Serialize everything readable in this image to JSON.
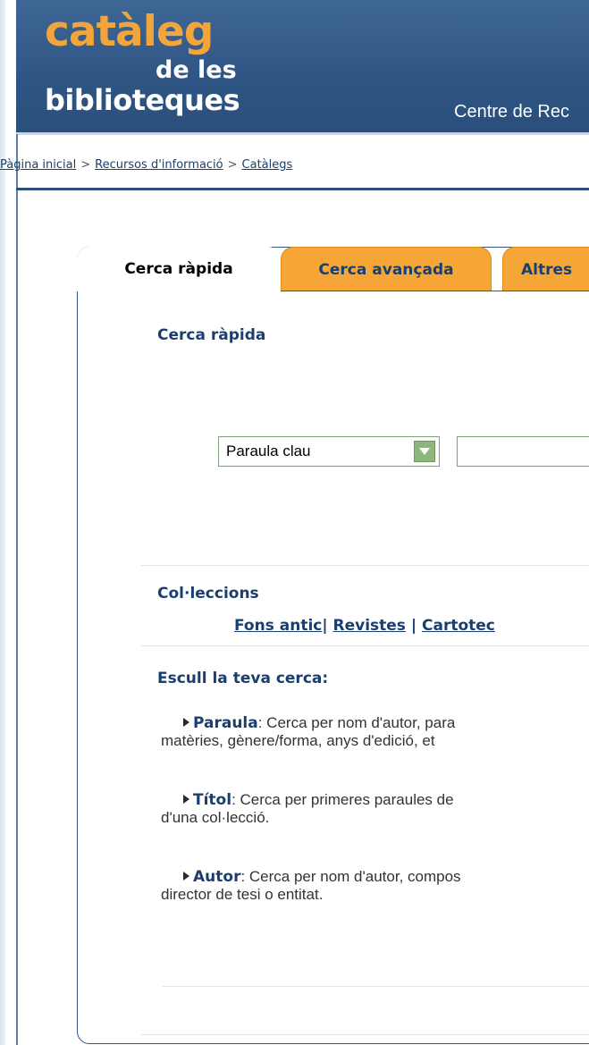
{
  "header": {
    "logo_line1": "catàleg",
    "logo_line2": "de les",
    "logo_line3": "biblioteques",
    "centre_text": "Centre de Rec"
  },
  "breadcrumb": {
    "home": "Pàgina inicial",
    "separator": ">",
    "resources": "Recursos d'informació",
    "catalogs": "Catàlegs"
  },
  "tabs": [
    {
      "label": "Cerca ràpida",
      "active": true
    },
    {
      "label": "Cerca avançada",
      "active": false
    },
    {
      "label": "Altres",
      "active": false
    }
  ],
  "quick_search": {
    "title": "Cerca ràpida",
    "select_value": "Paraula clau",
    "input_value": ""
  },
  "collections": {
    "title": "Col·leccions",
    "links": [
      {
        "label": "Fons antic"
      },
      {
        "label": "Revistes"
      },
      {
        "label": "Cartotec"
      }
    ],
    "separator": "|"
  },
  "help": {
    "title": "Escull la teva cerca:",
    "items": [
      {
        "keyword": "Paraula",
        "line1": ": Cerca per nom d'autor, para",
        "line2": "matèries, gènere/forma, anys d'edició, et"
      },
      {
        "keyword": "Títol",
        "line1": ": Cerca per primeres paraules de",
        "line2": "d'una col·lecció."
      },
      {
        "keyword": "Autor",
        "line1": ": Cerca per nom d'autor, compos",
        "line2": "director de tesi o entitat."
      }
    ]
  },
  "colors": {
    "banner": "#2f5584",
    "accent_orange": "#f6a636",
    "link_blue": "#1a3f6e",
    "select_green": "#8fb57f"
  }
}
